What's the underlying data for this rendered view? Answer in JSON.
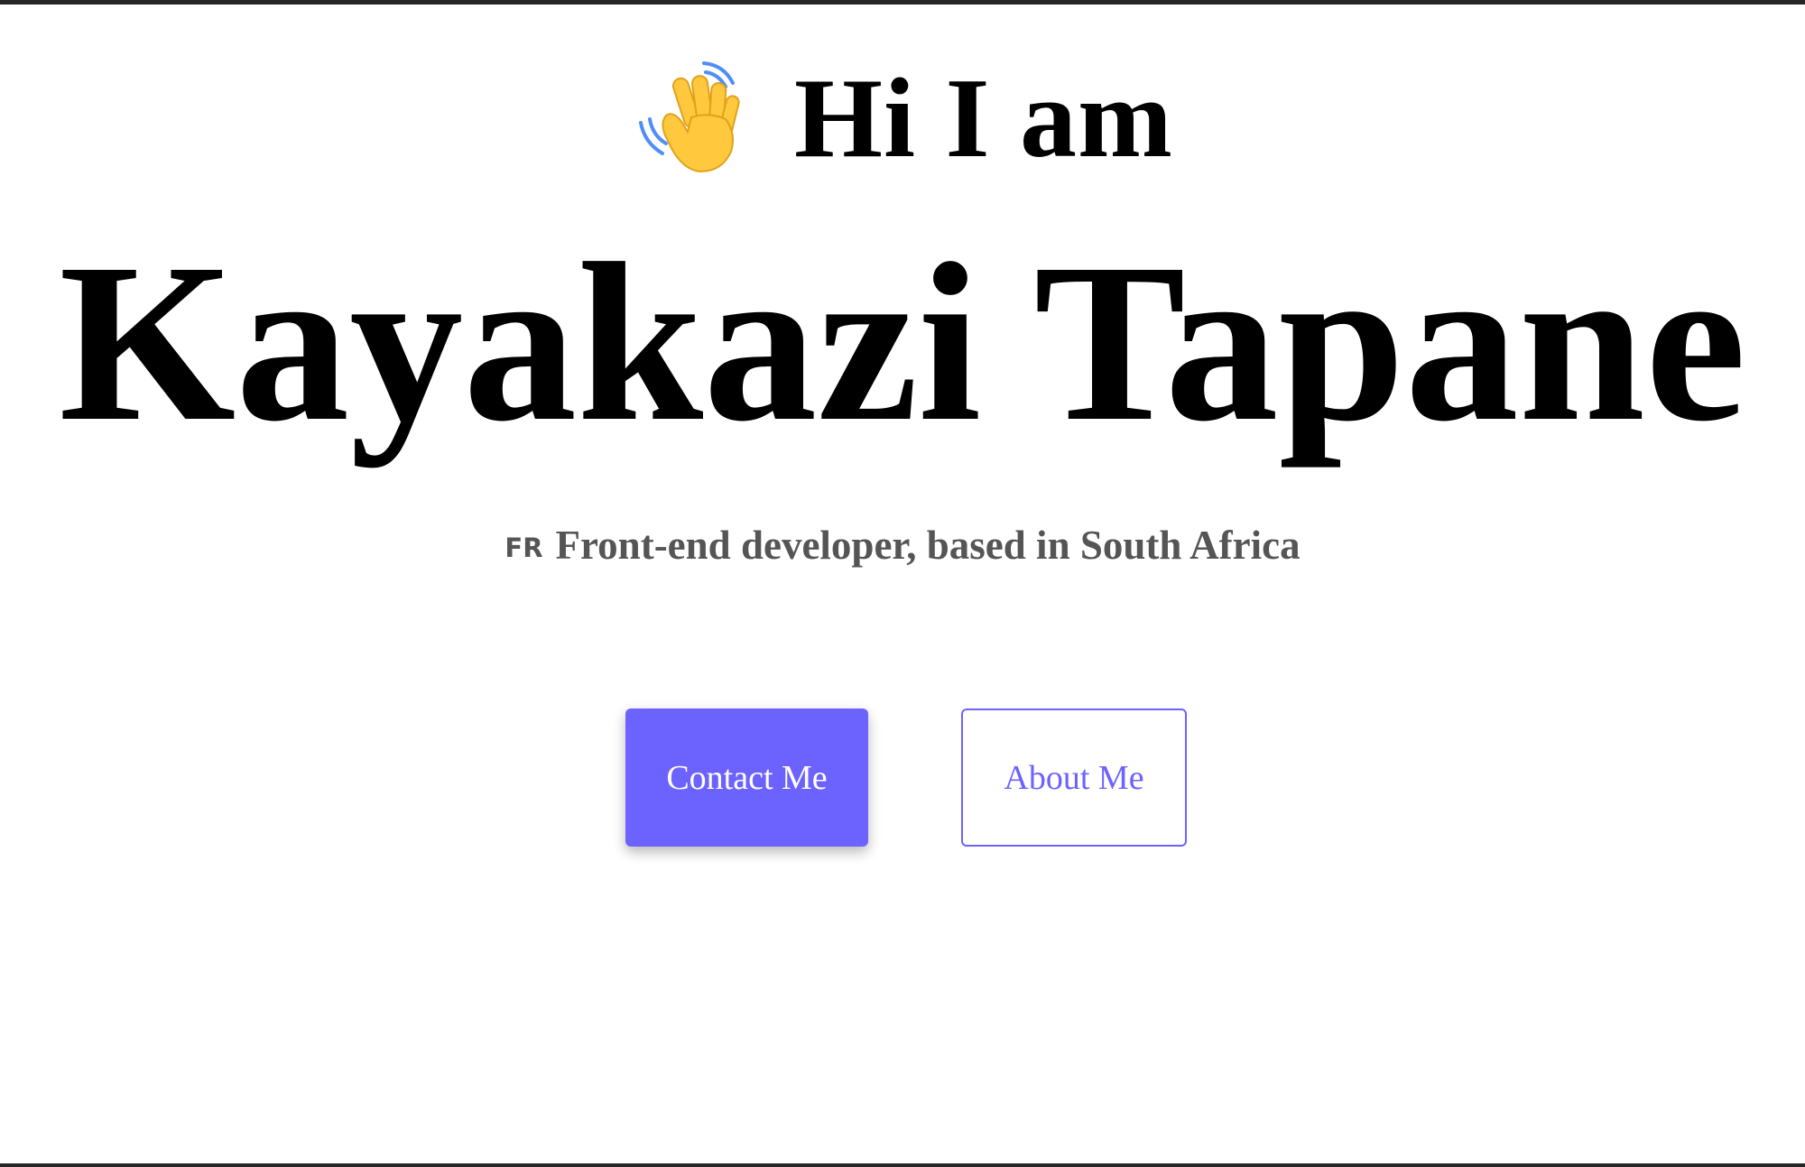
{
  "hero": {
    "greeting_icon": "waving-hand-icon",
    "greeting": "Hi I am",
    "name": "Kayakazi Tapane",
    "flag_code": "FR",
    "tagline": "Front-end developer, based in South Africa"
  },
  "buttons": {
    "contact_label": "Contact Me",
    "about_label": "About Me"
  },
  "colors": {
    "accent": "#6c63ff",
    "text": "#000000",
    "tagline": "#555555",
    "wave_hand": "#ffc83d",
    "wave_lines": "#4f8ef7"
  }
}
